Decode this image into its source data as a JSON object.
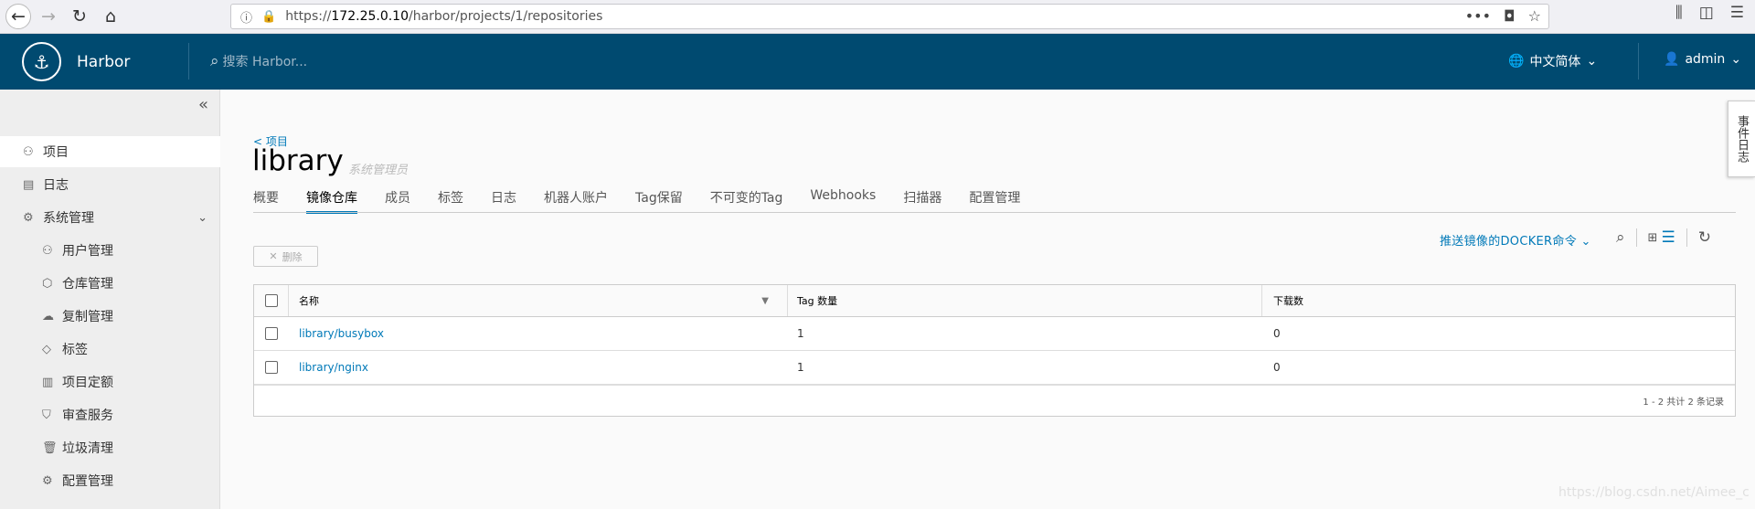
{
  "browser": {
    "url_prefix": "https://",
    "url_host": "172.25.0.10",
    "url_path": "/harbor/projects/1/repositories",
    "icons": [
      "back-icon",
      "forward-icon",
      "reload-icon",
      "home-icon",
      "info-icon",
      "lock-warning-icon",
      "more-icon",
      "pocket-icon",
      "bookmark-star-icon",
      "library-icon",
      "sidebar-icon",
      "menu-icon"
    ]
  },
  "header": {
    "brand": "Harbor",
    "search_placeholder": "搜索 Harbor...",
    "language": "中文简体",
    "user": "admin"
  },
  "sidebar": {
    "items": [
      {
        "label": "项目",
        "icon": "project-icon",
        "active": true
      },
      {
        "label": "日志",
        "icon": "log-icon"
      },
      {
        "label": "系统管理",
        "icon": "admin-icon"
      }
    ],
    "admin_items": [
      {
        "label": "用户管理",
        "icon": "users-icon"
      },
      {
        "label": "仓库管理",
        "icon": "registry-icon"
      },
      {
        "label": "复制管理",
        "icon": "replication-icon"
      },
      {
        "label": "标签",
        "icon": "tag-icon"
      },
      {
        "label": "项目定额",
        "icon": "quota-icon"
      },
      {
        "label": "审查服务",
        "icon": "shield-icon"
      },
      {
        "label": "垃圾清理",
        "icon": "trash-icon"
      },
      {
        "label": "配置管理",
        "icon": "gear-icon"
      }
    ]
  },
  "project": {
    "back_label": "< 项目",
    "name": "library",
    "role": "系统管理员",
    "tabs": [
      "概要",
      "镜像仓库",
      "成员",
      "标签",
      "日志",
      "机器人账户",
      "Tag保留",
      "不可变的Tag",
      "Webhooks",
      "扫描器",
      "配置管理"
    ],
    "active_tab": "镜像仓库"
  },
  "toolbar": {
    "push_command": "推送镜像的DOCKER命令",
    "delete_label": "删除"
  },
  "table": {
    "headers": {
      "name": "名称",
      "tags": "Tag 数量",
      "pulls": "下载数"
    },
    "rows": [
      {
        "name": "library/busybox",
        "tags": "1",
        "pulls": "0"
      },
      {
        "name": "library/nginx",
        "tags": "1",
        "pulls": "0"
      }
    ],
    "footer": "1 - 2 共计 2 条记录"
  },
  "event_log": "事件日志",
  "watermark": "https://blog.csdn.net/Aimee_c"
}
